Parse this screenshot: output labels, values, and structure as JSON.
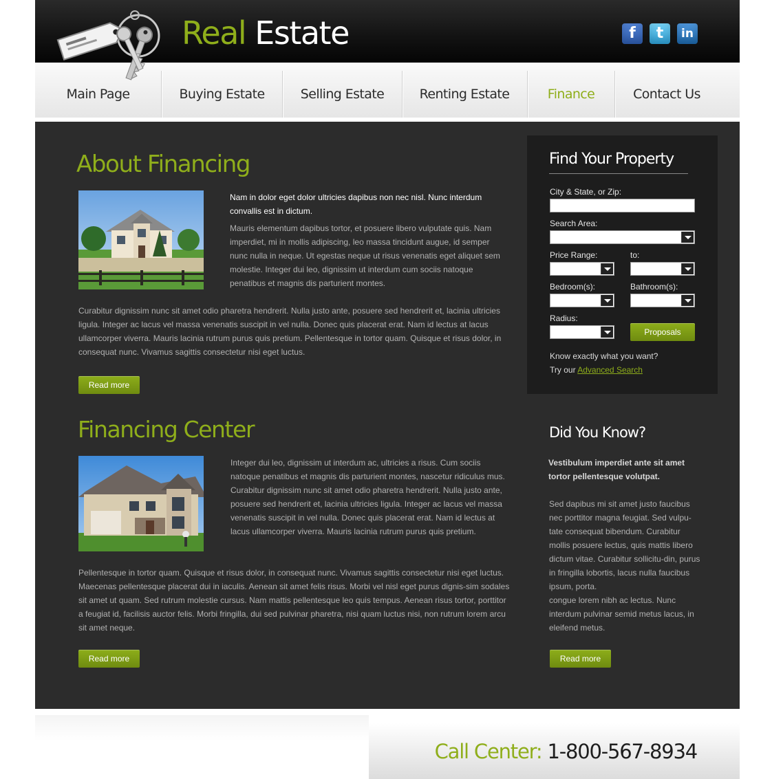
{
  "brand": {
    "word1": "Real",
    "word2": "Estate"
  },
  "social": [
    {
      "name": "facebook",
      "glyph": "f"
    },
    {
      "name": "twitter",
      "glyph": "t"
    },
    {
      "name": "linkedin",
      "glyph": "in"
    }
  ],
  "nav": {
    "items": [
      {
        "label": "Main Page",
        "active": false
      },
      {
        "label": "Buying Estate",
        "active": false
      },
      {
        "label": "Selling Estate",
        "active": false
      },
      {
        "label": "Renting Estate",
        "active": false
      },
      {
        "label": "Finance",
        "active": true
      },
      {
        "label": "Contact Us",
        "active": false
      }
    ]
  },
  "about": {
    "title": "About Financing",
    "lead": "Nam in dolor eget dolor ultricies dapibus non nec nisl. Nunc interdum convallis est in dictum.",
    "body": "Mauris elementum dapibus tortor, et posuere libero vulputate quis. Nam imperdiet, mi in mollis adipiscing, leo massa tincidunt augue, id semper nunc nulla in neque. Ut egestas neque ut risus venenatis eget aliquet sem molestie. Integer dui leo, dignissim ut interdum cum sociis natoque penatibus et magnis dis parturient montes.",
    "body2": "Curabitur dignissim nunc sit amet odio pharetra hendrerit. Nulla justo ante, posuere sed hendrerit et, lacinia ultricies ligula. Integer ac lacus vel massa venenatis suscipit in vel nulla. Donec quis placerat erat. Nam id lectus at lacus ullamcorper viverra. Mauris lacinia rutrum purus quis pretium. Pellentesque in tortor quam. Quisque et risus dolor, in consequat nunc. Vivamus sagittis consectetur nisi eget luctus.",
    "button": "Read more"
  },
  "center": {
    "title": "Financing Center",
    "body": "Integer dui leo, dignissim ut interdum ac, ultricies a risus. Cum sociis natoque penatibus et magnis dis parturient montes, nascetur ridiculus mus. Curabitur dignissim nunc sit amet odio pharetra hendrerit. Nulla justo ante, posuere sed hendrerit et, lacinia ultricies ligula. Integer ac lacus vel massa venenatis suscipit in vel nulla. Donec quis placerat erat. Nam id lectus at lacus ullamcorper viverra. Mauris lacinia rutrum purus quis pretium.",
    "body2": "Pellentesque in tortor quam. Quisque et risus dolor, in consequat nunc. Vivamus sagittis consectetur nisi eget luctus. Maecenas pellentesque placerat dui in iaculis. Aenean sit amet felis risus. Morbi vel nisl eget purus dignis-sim sodales sit amet ut quam. Sed rutrum molestie cursus. Nam mattis pellentesque leo quis tempus. Aenean risus tortor, porttitor a feugiat id, facilisis auctor felis. Morbi fringilla, dui sed pulvinar pharetra, nisi quam luctus nisi, non rutrum lorem arcu sit amet neque.",
    "button": "Read more"
  },
  "search": {
    "title": "Find Your Property",
    "city_label": "City & State, or Zip:",
    "city_value": "",
    "area_label": "Search Area:",
    "price_label": "Price Range:",
    "to_label": "to:",
    "bed_label": "Bedroom(s):",
    "bath_label": "Bathroom(s):",
    "radius_label": "Radius:",
    "button": "Proposals",
    "know_text": "Know exactly what you want?",
    "try_text": "Try our",
    "advanced_link": "Advanced Search"
  },
  "dyk": {
    "title": "Did You Know?",
    "lead": "Vestibulum imperdiet ante sit amet tortor pellentesque volutpat.",
    "body": "Sed dapibus mi sit amet justo faucibus nec porttitor magna feugiat. Sed vulpu-tate consequat bibendum. Curabitur mollis posuere lectus, quis mattis libero dictum vitae. Curabitur sollicitu-din, purus in fringilla lobortis, lacus nulla faucibus ipsum, porta.",
    "body2": "congue lorem nibh ac lectus. Nunc interdum pulvinar semid metus lacus, in eleifend metus.",
    "button": "Read more"
  },
  "footer": {
    "call_label": "Call Center:",
    "phone": "1-800-567-8934"
  },
  "colors": {
    "accent": "#8fae1b",
    "content_bg": "#2c2c2c",
    "search_bg": "#1d1d1d",
    "header_bg": "#121212"
  }
}
